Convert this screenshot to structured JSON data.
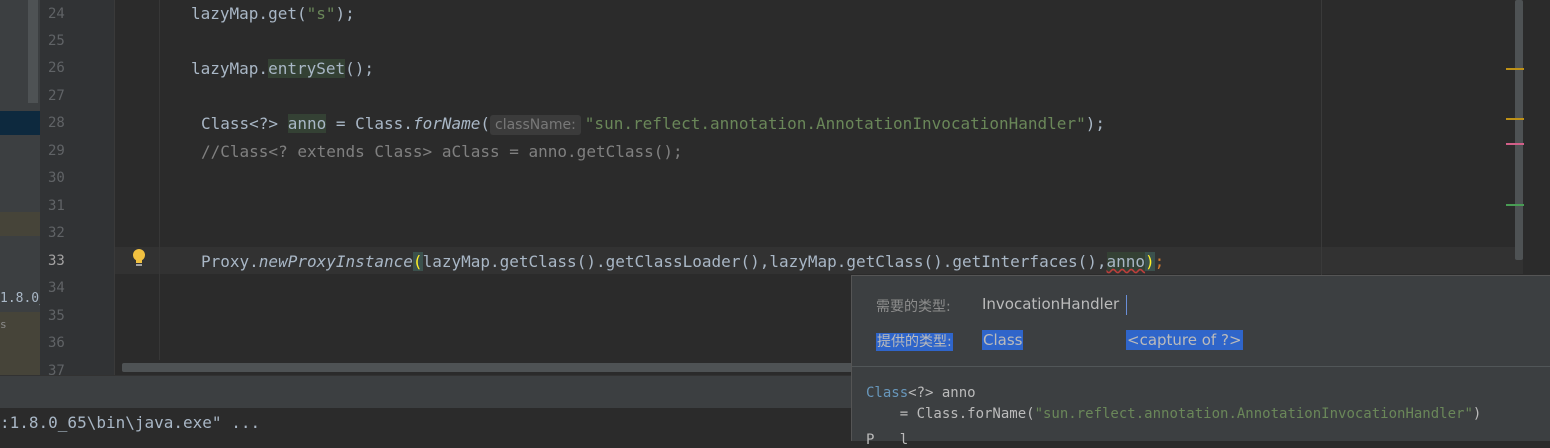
{
  "editor": {
    "line_numbers": [
      "24",
      "25",
      "26",
      "27",
      "28",
      "29",
      "30",
      "31",
      "32",
      "33",
      "34",
      "35",
      "36",
      "37"
    ],
    "current_line": "33",
    "lines": {
      "l24": {
        "a": "lazyMap.get(",
        "s": "\"s\"",
        "b": ");"
      },
      "l26": {
        "a": "lazyMap.",
        "hl": "entrySet",
        "b": "();"
      },
      "l28": {
        "a": "Class<?> ",
        "anno": "anno",
        "b": " = Class.",
        "fn": "forName",
        "c": "(",
        "hint": "className:",
        "s": "\"sun.reflect.annotation.AnnotationInvocationHandler\"",
        "d": ");"
      },
      "l29": {
        "comment": "//Class<? extends Class> aClass = anno.getClass();"
      },
      "l33": {
        "a": "Proxy.",
        "fn": "newProxyInstance",
        "open": "(",
        "b": "lazyMap.getClass().getClassLoader(),lazyMap.getClass().getInterfaces(),",
        "err": "anno",
        "close": ")",
        "d": ";"
      }
    }
  },
  "left_panel": {
    "version_text": "1.8.0_",
    "fragment_text": "s"
  },
  "console": {
    "text": ":1.8.0_65\\bin\\java.exe\" ..."
  },
  "popup": {
    "required_label": "需要的类型:",
    "required_value": "InvocationHandler",
    "provided_label": "提供的类型:",
    "provided_value": "Class",
    "provided_capture": "<capture of ?>",
    "decl_kw": "Class",
    "decl_rest": "<?> anno",
    "decl_line2_a": "    = Class.forName(",
    "decl_line2_s": "\"sun.reflect.annotation.AnnotationInvocationHandler\"",
    "decl_line2_b": ")",
    "footer_partial": "P   l"
  },
  "colors": {
    "bg": "#2b2b2b",
    "string": "#6a8759",
    "selection": "#2f65ca",
    "marker_warning": "#be9117",
    "marker_error": "#d25f88",
    "marker_ok": "#499c54"
  }
}
